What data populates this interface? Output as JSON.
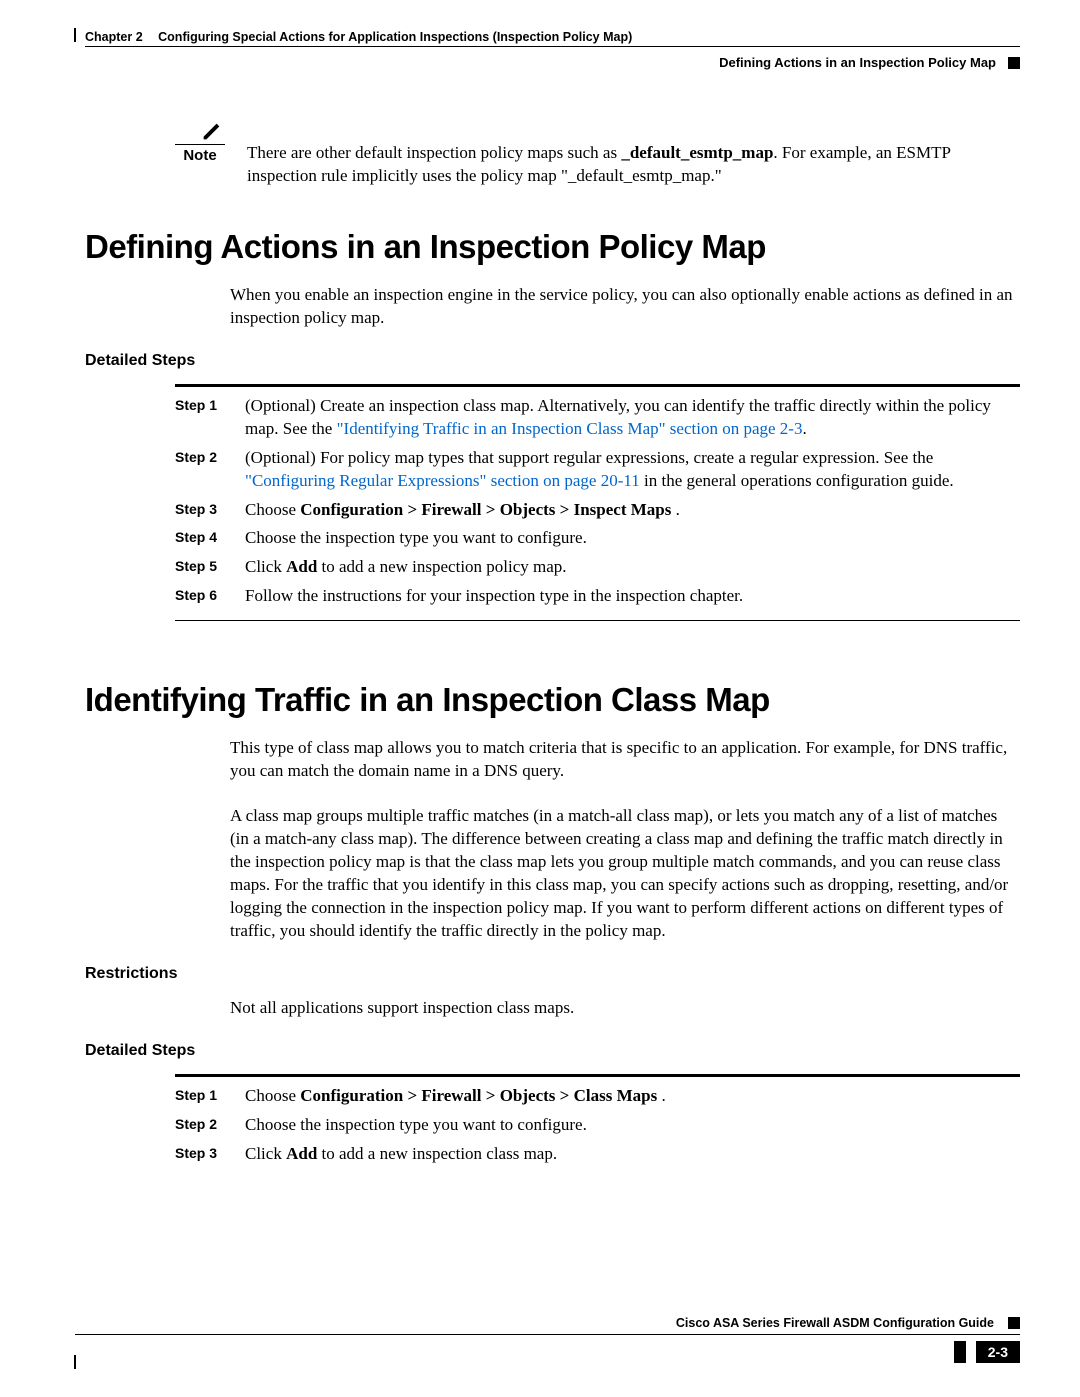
{
  "header": {
    "chapter_label": "Chapter 2",
    "chapter_title": "Configuring Special Actions for Application Inspections (Inspection Policy Map)",
    "section_name": "Defining Actions in an Inspection Policy Map"
  },
  "note": {
    "label": "Note",
    "pre": "There are other default inspection policy maps such as ",
    "bold": "_default_esmtp_map",
    "post": ". For example, an ESMTP inspection rule implicitly uses the policy map \"_default_esmtp_map.\""
  },
  "section1": {
    "title": "Defining Actions in an Inspection Policy Map",
    "intro": "When you enable an inspection engine in the service policy, you can also optionally enable actions as defined in an inspection policy map.",
    "detailed_label": "Detailed Steps",
    "steps": [
      {
        "label": "Step 1",
        "pre": "(Optional) Create an inspection class map. Alternatively, you can identify the traffic directly within the policy map. See the ",
        "link": "\"Identifying Traffic in an Inspection Class Map\" section on page 2-3",
        "post": "."
      },
      {
        "label": "Step 2",
        "pre": "(Optional) For policy map types that support regular expressions, create a regular expression. See the ",
        "link": "\"Configuring Regular Expressions\" section on page 20-11",
        "post": " in the general operations configuration guide."
      },
      {
        "label": "Step 3",
        "pre": "Choose ",
        "bold": "Configuration > Firewall > Objects > Inspect Maps",
        "post": " ."
      },
      {
        "label": "Step 4",
        "text": "Choose the inspection type you want to configure."
      },
      {
        "label": "Step 5",
        "pre": "Click ",
        "bold": "Add",
        "post": " to add a new inspection policy map."
      },
      {
        "label": "Step 6",
        "text": "Follow the instructions for your inspection type in the inspection chapter."
      }
    ]
  },
  "section2": {
    "title": "Identifying Traffic in an Inspection Class Map",
    "p1": "This type of class map allows you to match criteria that is specific to an application. For example, for DNS traffic, you can match the domain name in a DNS query.",
    "p2": "A class map groups multiple traffic matches (in a match-all class map), or lets you match any of a list of matches (in a match-any class map). The difference between creating a class map and defining the traffic match directly in the inspection policy map is that the class map lets you group multiple match commands, and you can reuse class maps. For the traffic that you identify in this class map, you can specify actions such as dropping, resetting, and/or logging the connection in the inspection policy map. If you want to perform different actions on different types of traffic, you should identify the traffic directly in the policy map.",
    "restrictions_label": "Restrictions",
    "restrictions_text": "Not all applications support inspection class maps.",
    "detailed_label": "Detailed Steps",
    "steps": [
      {
        "label": "Step 1",
        "pre": "Choose ",
        "bold": "Configuration > Firewall > Objects > Class Maps",
        "post": " ."
      },
      {
        "label": "Step 2",
        "text": "Choose the inspection type you want to configure."
      },
      {
        "label": "Step 3",
        "pre": "Click ",
        "bold": "Add",
        "post": " to add a new inspection class map."
      }
    ]
  },
  "footer": {
    "guide": "Cisco ASA Series Firewall ASDM Configuration Guide",
    "page": "2-3"
  }
}
